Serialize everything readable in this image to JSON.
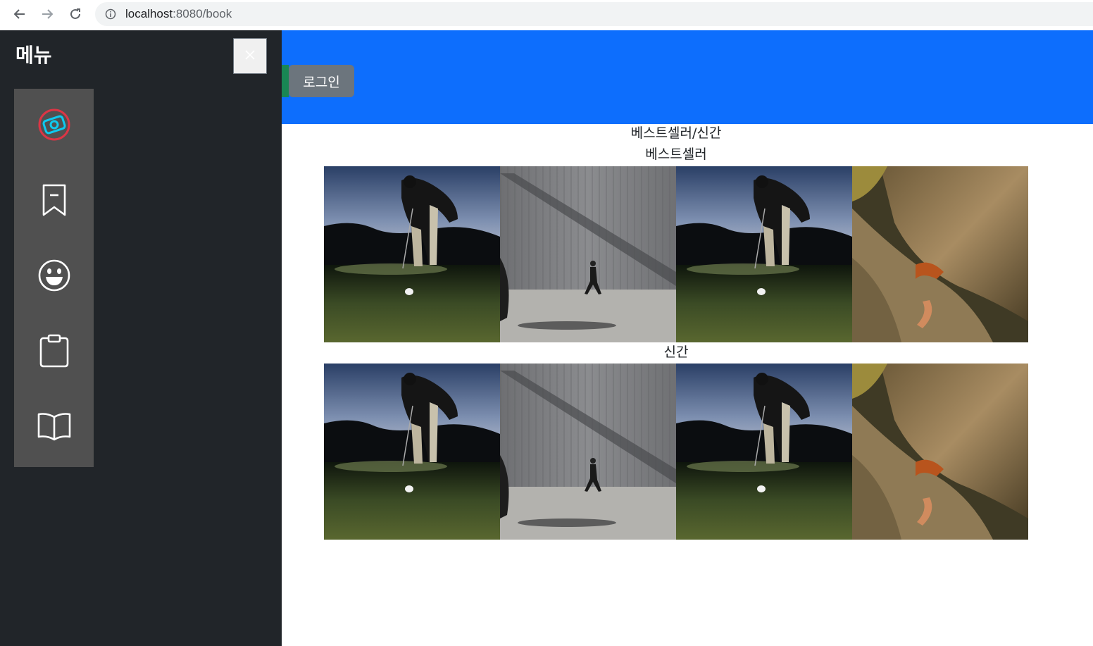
{
  "browser": {
    "url_host": "localhost",
    "url_path": ":8080/book",
    "back_icon": "arrow-left-icon",
    "forward_icon": "arrow-right-icon",
    "reload_icon": "reload-icon",
    "info_icon": "info-icon"
  },
  "header": {
    "login_label": "로그인",
    "accent_color": "#0d6efd"
  },
  "sidebar": {
    "title": "메뉴",
    "close_icon": "close-icon",
    "items": [
      {
        "icon": "camera-logo-icon"
      },
      {
        "icon": "bookmark-icon"
      },
      {
        "icon": "smile-icon"
      },
      {
        "icon": "clipboard-icon"
      },
      {
        "icon": "book-open-icon"
      }
    ]
  },
  "main": {
    "page_heading": "베스트셀러/신간",
    "bestseller": {
      "heading": "베스트셀러",
      "images": [
        "golfer-photo",
        "walking-man-photo",
        "golfer-photo",
        "climber-photo"
      ]
    },
    "new_releases": {
      "heading": "신간",
      "images": [
        "golfer-photo",
        "walking-man-photo",
        "golfer-photo",
        "climber-photo"
      ]
    }
  }
}
